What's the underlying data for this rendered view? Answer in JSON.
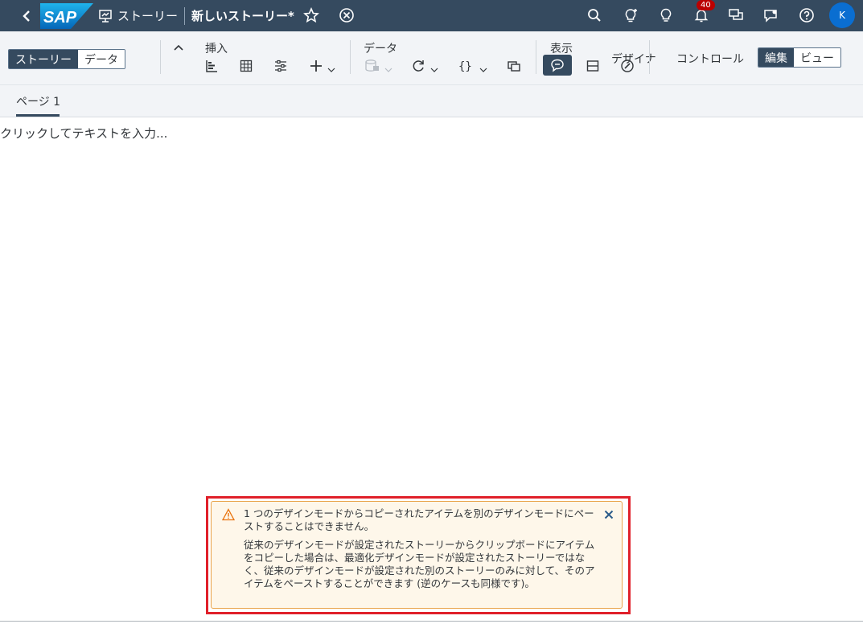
{
  "shell": {
    "logo": "SAP",
    "breadcrumb": "ストーリー",
    "title": "新しいストーリー*",
    "notification_count": "40",
    "avatar_initial": "K",
    "icons": [
      "back-icon",
      "presentation-icon",
      "star-icon",
      "close-circle-icon",
      "search-icon",
      "lightbulb-sparkle-icon",
      "lightbulb-icon",
      "bell-icon",
      "chat-icon",
      "feedback-icon",
      "help-icon"
    ]
  },
  "toolbar": {
    "mode_tabs": [
      {
        "label": "ストーリー",
        "active": true
      },
      {
        "label": "データ",
        "active": false
      }
    ],
    "insert_label": "挿入",
    "data_label": "データ",
    "display_label": "表示",
    "designer_label": "デザイナ",
    "control_label": "コントロール",
    "view_tabs": [
      {
        "label": "編集",
        "active": true
      },
      {
        "label": "ビュー",
        "active": false
      }
    ]
  },
  "tabs": {
    "page1": "ページ 1"
  },
  "canvas": {
    "placeholder": "クリックしてテキストを入力..."
  },
  "toast": {
    "line1": "1 つのデザインモードからコピーされたアイテムを別のデザインモードにペーストすることはできません。",
    "line2": "従来のデザインモードが設定されたストーリーからクリップボードにアイテムをコピーした場合は、最適化デザインモードが設定されたストーリーではなく、従来のデザインモードが設定された別のストーリーのみに対して、そのアイテムをペーストすることができます (逆のケースも同様です)。"
  }
}
